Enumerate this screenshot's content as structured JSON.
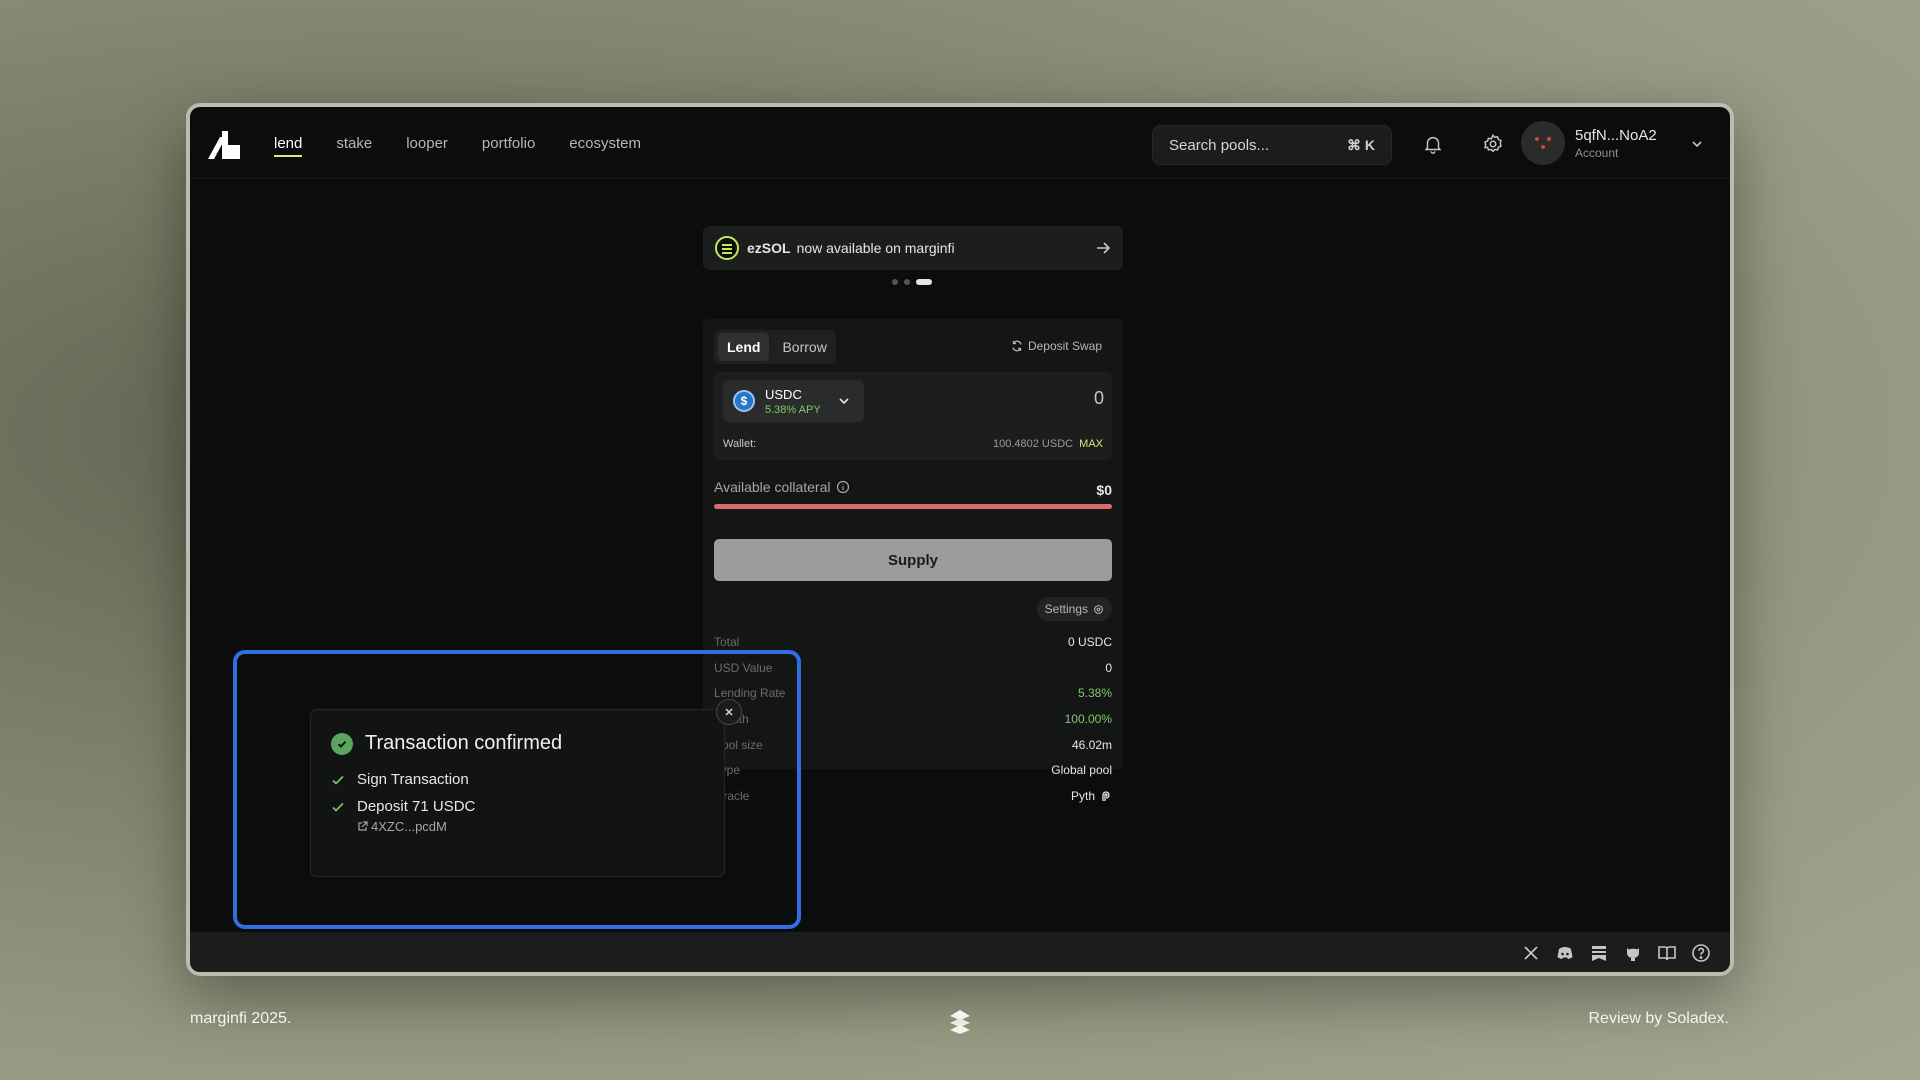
{
  "app": {
    "nav": [
      {
        "label": "lend",
        "active": true
      },
      {
        "label": "stake",
        "active": false
      },
      {
        "label": "looper",
        "active": false
      },
      {
        "label": "portfolio",
        "active": false
      },
      {
        "label": "ecosystem",
        "active": false
      }
    ],
    "search": {
      "placeholder": "Search pools...",
      "shortcut": "⌘ K"
    },
    "account": {
      "name": "5qfN...NoA2",
      "sub": "Account"
    },
    "accent_color": "#dce68c"
  },
  "banner": {
    "token": "ezSOL",
    "text": "now available on marginfi",
    "slides": 3,
    "active_slide": 3
  },
  "card": {
    "tabs": [
      {
        "label": "Lend",
        "active": true
      },
      {
        "label": "Borrow",
        "active": false
      }
    ],
    "deposit_swap": "Deposit Swap",
    "token": {
      "symbol": "USDC",
      "apy": "5.38% APY",
      "icon": "usdc-icon"
    },
    "amount_value": "0",
    "wallet_label": "Wallet:",
    "wallet_balance": "100.4802 USDC",
    "max_label": "MAX",
    "collateral_label": "Available collateral",
    "collateral_value": "$0",
    "supply_label": "Supply",
    "settings_label": "Settings",
    "stats": [
      {
        "label": "Total",
        "value": "0 USDC"
      },
      {
        "label": "USD Value",
        "value": "0"
      },
      {
        "label": "Lending Rate",
        "value": "5.38%"
      },
      {
        "label": "Health",
        "value": "100.00%"
      },
      {
        "label": "Pool size",
        "value": "46.02m"
      },
      {
        "label": "Type",
        "value": "Global pool"
      },
      {
        "label": "Oracle",
        "value": "Pyth"
      }
    ]
  },
  "toast": {
    "title": "Transaction confirmed",
    "steps": [
      {
        "label": "Sign Transaction"
      },
      {
        "label": "Deposit 71 USDC",
        "link": "4XZC...pcdM"
      }
    ],
    "success_color": "#5ba65e"
  },
  "page_footer": {
    "left": "marginfi 2025.",
    "right": "Review by Soladex."
  }
}
